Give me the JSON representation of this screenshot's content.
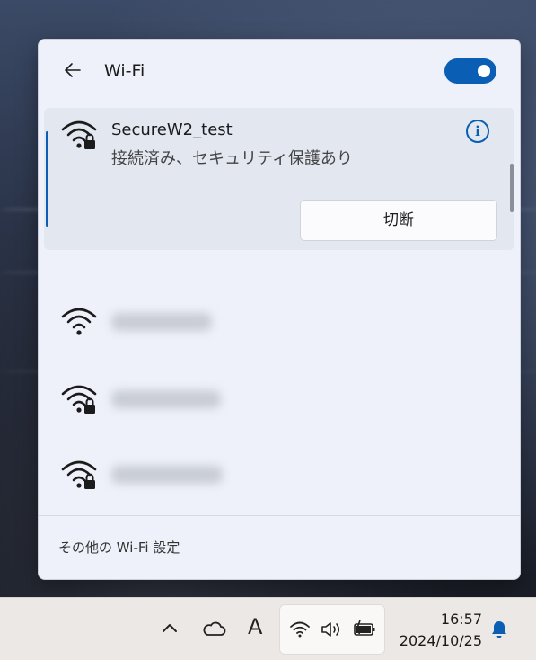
{
  "panel": {
    "title": "Wi-Fi",
    "toggle_on": true
  },
  "networks": [
    {
      "name": "SecureW2_test",
      "status": "接続済み、セキュリティ保護あり",
      "secured": true,
      "connected": true,
      "action": "切断"
    },
    {
      "name": "",
      "secured": false,
      "connected": false
    },
    {
      "name": "",
      "secured": true,
      "connected": false
    },
    {
      "name": "",
      "secured": true,
      "connected": false
    },
    {
      "name": "",
      "secured": false,
      "connected": false
    }
  ],
  "footer": {
    "more_settings": "その他の Wi-Fi 設定"
  },
  "taskbar": {
    "chevron": "^",
    "ime": "A",
    "time": "16:57",
    "date": "2024/10/25",
    "icons": [
      "chevron-up-icon",
      "onedrive-cloud-icon",
      "ime-icon",
      "wifi-icon",
      "volume-icon",
      "battery-charging-icon",
      "notification-bell-icon"
    ]
  },
  "colors": {
    "accent": "#0a5fb4",
    "panel_bg": "#eef1f9",
    "selected_bg": "#e3e7f0"
  }
}
